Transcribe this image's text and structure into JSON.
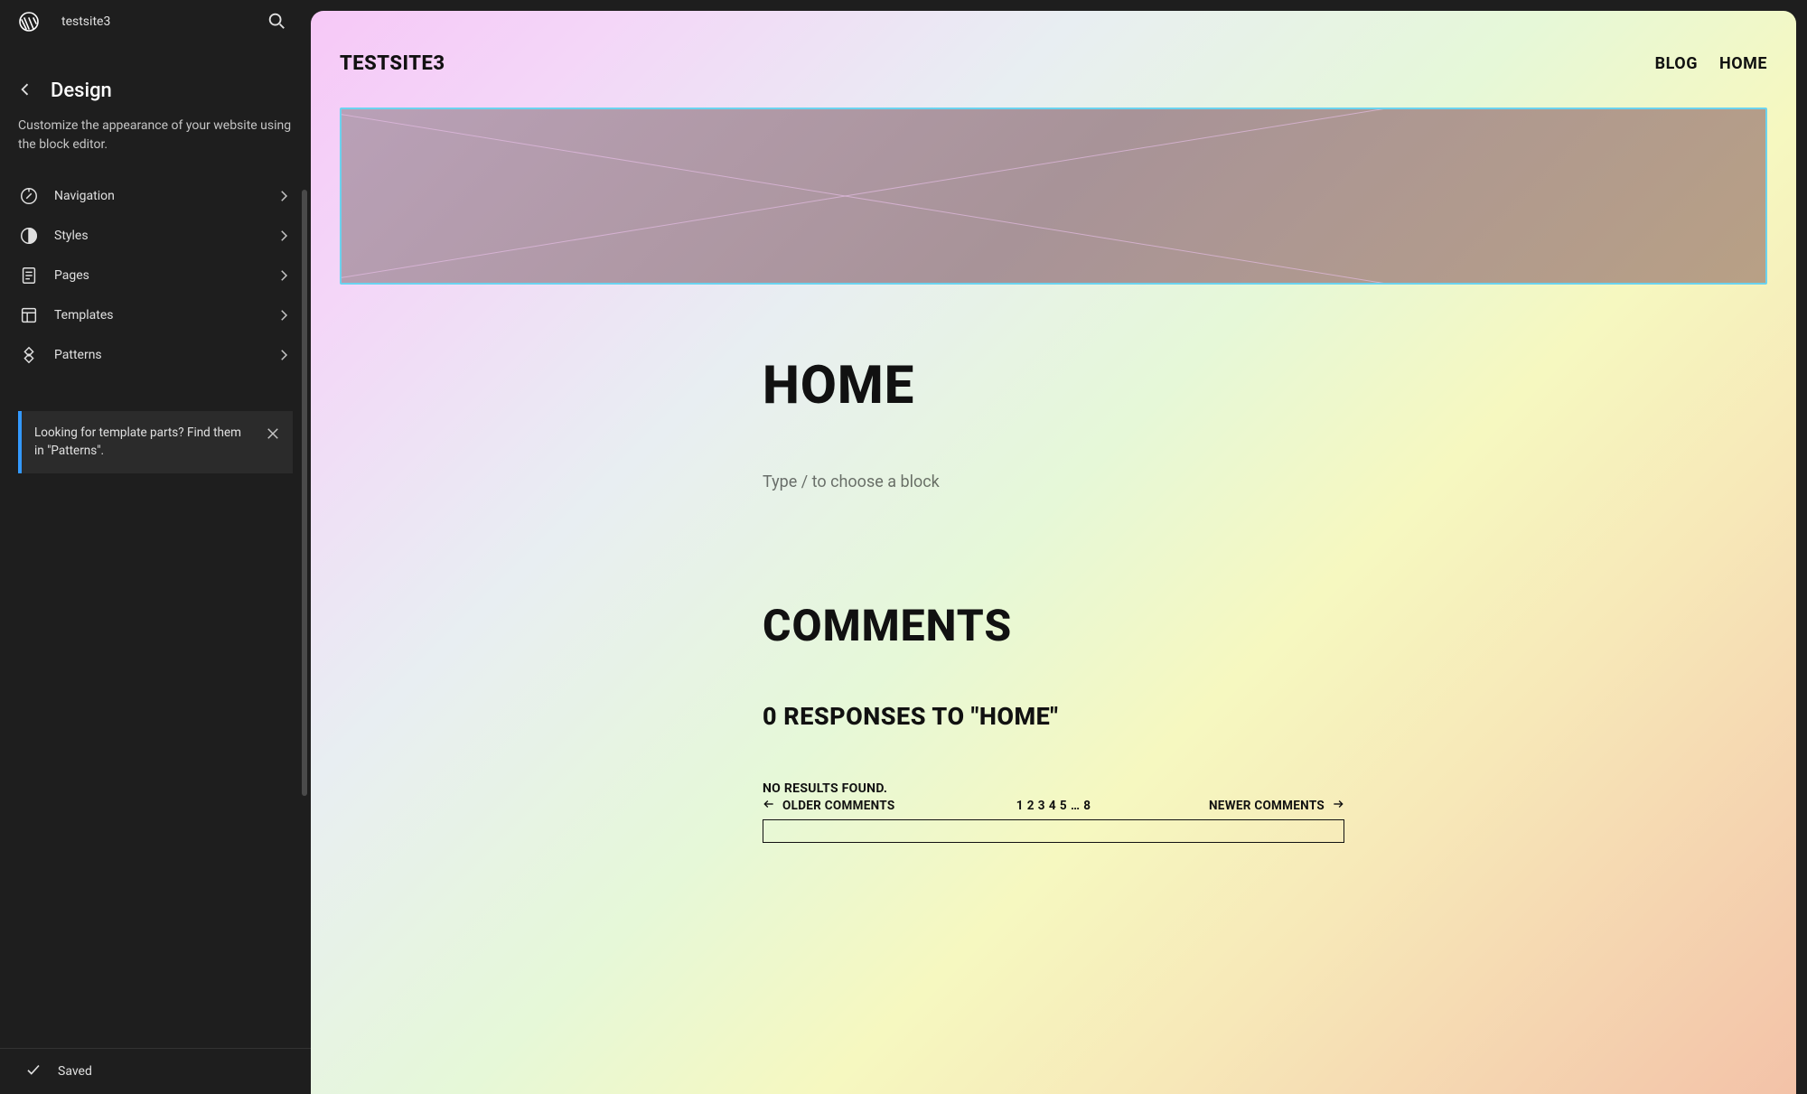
{
  "topbar": {
    "site_name": "testsite3"
  },
  "sidebar": {
    "title": "Design",
    "description": "Customize the appearance of your website using the block editor.",
    "items": [
      {
        "label": "Navigation",
        "icon": "compass-icon"
      },
      {
        "label": "Styles",
        "icon": "half-circle-icon"
      },
      {
        "label": "Pages",
        "icon": "page-icon"
      },
      {
        "label": "Templates",
        "icon": "layout-icon"
      },
      {
        "label": "Patterns",
        "icon": "diamond-grid-icon"
      }
    ],
    "notice": "Looking for template parts? Find them in \"Patterns\".",
    "footer_status": "Saved"
  },
  "preview": {
    "site_title": "TESTSITE3",
    "nav": [
      {
        "label": "BLOG"
      },
      {
        "label": "HOME"
      }
    ],
    "page_heading": "HOME",
    "block_prompt": "Type / to choose a block",
    "comments_heading": "COMMENTS",
    "responses_heading": "0 RESPONSES TO \"HOME\"",
    "no_results": "NO RESULTS FOUND.",
    "pager": {
      "older": "OLDER COMMENTS",
      "newer": "NEWER COMMENTS",
      "pages": [
        "1",
        "2",
        "3",
        "4",
        "5",
        "…",
        "8"
      ]
    }
  }
}
